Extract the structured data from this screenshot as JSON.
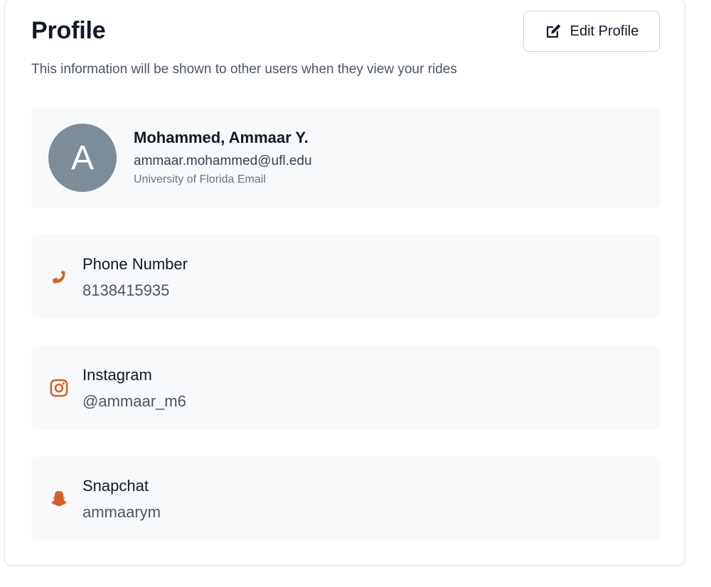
{
  "profile": {
    "title": "Profile",
    "subtitle": "This information will be shown to other users when they view your rides",
    "edit_label": "Edit Profile"
  },
  "user": {
    "avatar_initial": "A",
    "name": "Mohammed, Ammaar Y.",
    "email": "ammaar.mohammed@ufl.edu",
    "email_label": "University of Florida Email"
  },
  "contacts": {
    "phone": {
      "label": "Phone Number",
      "value": "8138415935",
      "icon": "phone-icon"
    },
    "instagram": {
      "label": "Instagram",
      "value": "@ammaar_m6",
      "icon": "instagram-icon"
    },
    "snapchat": {
      "label": "Snapchat",
      "value": "ammaarym",
      "icon": "snapchat-icon"
    }
  },
  "colors": {
    "accent": "#d2622a",
    "avatar_bg": "#7c8c99",
    "panel_bg": "#f8f9fb"
  }
}
